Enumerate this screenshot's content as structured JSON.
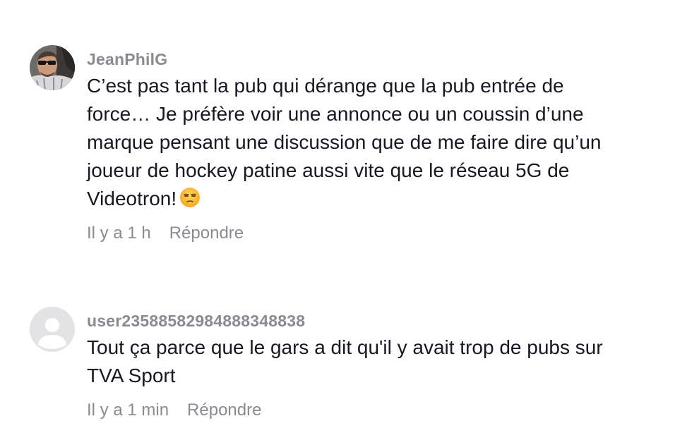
{
  "comments": [
    {
      "username": "JeanPhilG",
      "text": "C’est pas tant la pub qui dérange que la pub entrée de\nforce… Je préfère voir une annonce ou un coussin d’une\nmarque pensant une discussion que de me faire dire qu’un\njoueur de hockey patine aussi vite que le réseau 5G de\nVideotron!",
      "emoji": "unamused-face",
      "time": "Il y a 1 h",
      "reply_label": "Répondre",
      "avatar": "user-photo"
    },
    {
      "username": "user2358858298488834883­8",
      "text": "Tout ça parce que le gars a dit qu'il y avait trop de pubs sur\nTVA Sport",
      "time": "Il y a 1 min",
      "reply_label": "Répondre",
      "avatar": "default-user-icon"
    }
  ]
}
